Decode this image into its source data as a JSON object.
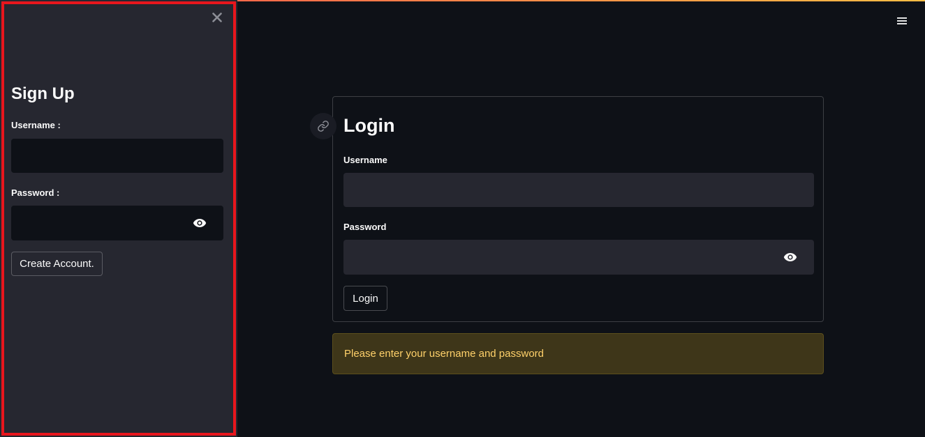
{
  "sidebar": {
    "title": "Sign Up",
    "username_label": "Username :",
    "username_value": "",
    "password_label": "Password :",
    "password_value": "",
    "create_button_label": "Create Account.",
    "close_icon": "close-icon",
    "eye_icon": "eye-icon"
  },
  "main": {
    "title": "Login",
    "username_label": "Username",
    "username_value": "",
    "password_label": "Password",
    "password_value": "",
    "login_button_label": "Login",
    "warning_message": "Please enter your username and password",
    "anchor_icon": "link-icon",
    "menu_icon": "hamburger-menu-icon"
  },
  "colors": {
    "background": "#0e1117",
    "sidebar_background": "#262730",
    "highlight_border": "#e8161d",
    "warning_background": "#3e3619",
    "warning_text": "#ffd16a"
  }
}
